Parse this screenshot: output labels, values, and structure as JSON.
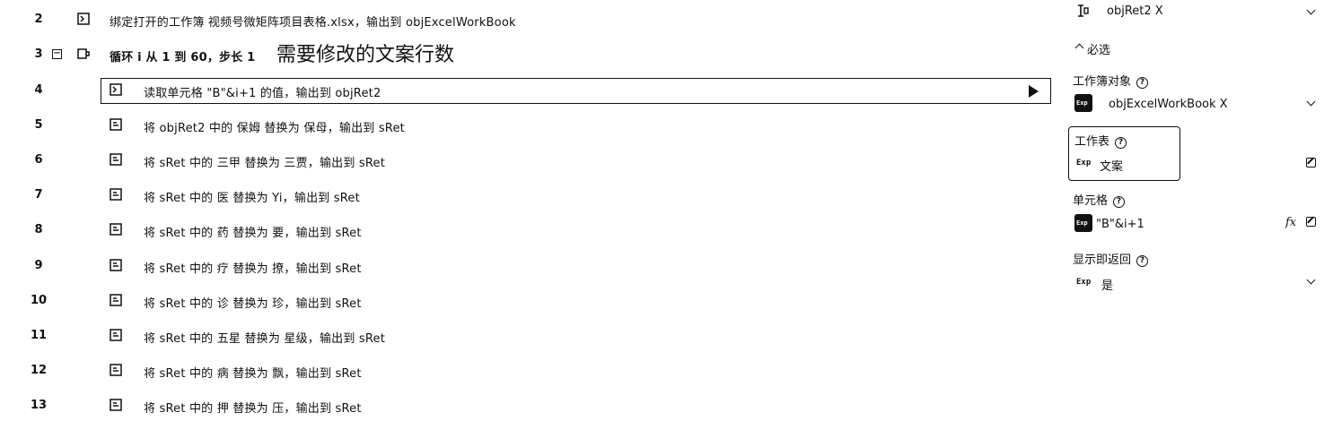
{
  "script": {
    "annotation": "需要修改的文案行数",
    "rows": [
      {
        "line": "2",
        "text": "绑定打开的工作簿 视频号微矩阵项目表格.xlsx，输出到   objExcelWorkBook"
      },
      {
        "line": "3",
        "text": "循环 i 从 1 到 60，步长 1"
      },
      {
        "line": "4",
        "text": "读取单元格 \"B\"&i+1 的值，输出到   objRet2"
      },
      {
        "line": "5",
        "text": "将 objRet2 中的 保姆 替换为 保母，输出到   sRet"
      },
      {
        "line": "6",
        "text": "将 sRet 中的 三甲 替换为 三贾，输出到   sRet"
      },
      {
        "line": "7",
        "text": "将 sRet 中的 医 替换为 Yi，输出到   sRet"
      },
      {
        "line": "8",
        "text": "将 sRet 中的 药 替换为 要，输出到   sRet"
      },
      {
        "line": "9",
        "text": "将 sRet 中的 疗 替换为 撩，输出到   sRet"
      },
      {
        "line": "10",
        "text": "将 sRet 中的 诊 替换为 珍，输出到   sRet"
      },
      {
        "line": "11",
        "text": "将 sRet 中的 五星 替换为 星级，输出到   sRet"
      },
      {
        "line": "12",
        "text": "将 sRet 中的 病 替换为 飘，输出到   sRet"
      },
      {
        "line": "13",
        "text": "将 sRet 中的 押 替换为 压，输出到   sRet"
      }
    ]
  },
  "props": {
    "output_var": "objRet2 X",
    "required_section": "必选",
    "workbook_label": "工作簿对象",
    "workbook_value": "objExcelWorkBook X",
    "sheet_label": "工作表",
    "sheet_value": "文案",
    "cell_label": "单元格",
    "cell_value": "\"B\"&i+1",
    "show_return_label": "显示即返回",
    "show_return_value": "是",
    "exp_tag": "Exp",
    "fx_label": "fx",
    "help_glyph": "?"
  },
  "icons": {
    "open_workbook": "workbook-bind-icon",
    "loop": "loop-icon",
    "read_cell": "read-cell-icon",
    "replace": "text-replace-icon"
  }
}
